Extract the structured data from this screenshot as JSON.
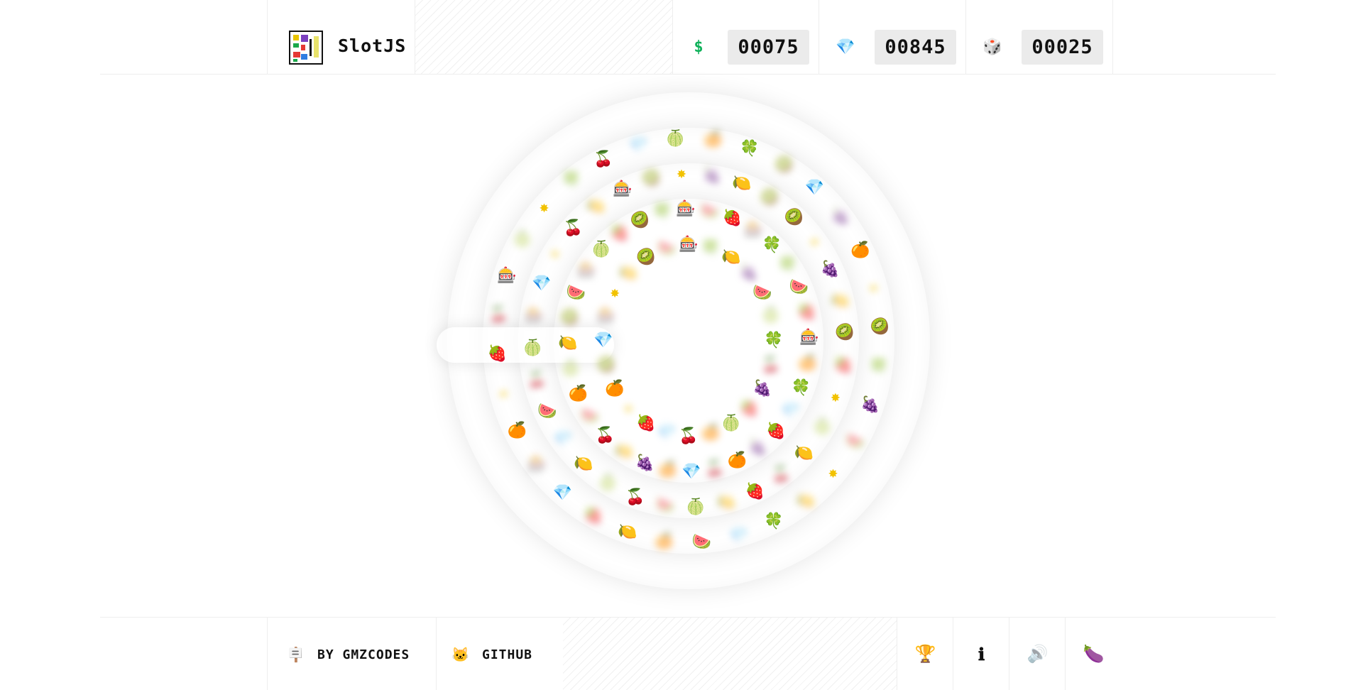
{
  "app": {
    "title": "SlotJS"
  },
  "counters": [
    {
      "name": "money",
      "icon": "dollar-icon",
      "glyph": "$",
      "color": "#0fb15a",
      "value": "00075"
    },
    {
      "name": "gems",
      "icon": "diamond-icon",
      "glyph": "💎",
      "color": "#1e88e5",
      "value": "00845"
    },
    {
      "name": "spins",
      "icon": "dice-icon",
      "glyph": "🎲",
      "color": "#7a7a9a",
      "value": "00025"
    }
  ],
  "footer": {
    "byline": {
      "label": "BY GMZCODES",
      "icon": "signpost-icon",
      "glyph": "🪧"
    },
    "github": {
      "label": "GITHUB",
      "icon": "github-cat-icon",
      "glyph": "🐱"
    },
    "buttons": [
      {
        "name": "trophy-button",
        "icon": "trophy-icon",
        "glyph": "🏆"
      },
      {
        "name": "info-button",
        "icon": "info-icon",
        "glyph": "ℹ"
      },
      {
        "name": "sound-button",
        "icon": "speaker-icon",
        "glyph": "🔊"
      },
      {
        "name": "eggplant-button",
        "icon": "eggplant-icon",
        "glyph": "🍆"
      }
    ]
  },
  "symbols": {
    "clover": "🍀",
    "star": "✸",
    "kiwi": "🥝",
    "lemon": "🍋",
    "watermelon": "🍉",
    "grapes": "🍇",
    "strawberry": "🍓",
    "orange": "🍊",
    "diamond": "💎",
    "cherries": "🍒",
    "melon": "🍈",
    "slot": "🎰"
  },
  "reels": [
    {
      "name": "reel-1",
      "symbols": [
        "clover",
        "grapes",
        "melon",
        "cherries",
        "strawberry",
        "orange",
        "diamond",
        "star",
        "kiwi",
        "slot",
        "lemon",
        "watermelon"
      ]
    },
    {
      "name": "reel-2",
      "symbols": [
        "clover",
        "strawberry",
        "orange",
        "diamond",
        "grapes",
        "cherries",
        "orange",
        "lemon",
        "watermelon",
        "melon",
        "kiwi",
        "slot",
        "strawberry",
        "clover",
        "watermelon",
        "slot"
      ]
    },
    {
      "name": "reel-3",
      "symbols": [
        "lemon",
        "strawberry",
        "melon",
        "cherries",
        "lemon",
        "watermelon",
        "melon",
        "diamond",
        "cherries",
        "slot",
        "star",
        "lemon",
        "kiwi",
        "grapes",
        "kiwi",
        "star"
      ]
    },
    {
      "name": "reel-4",
      "symbols": [
        "clover",
        "watermelon",
        "lemon",
        "diamond",
        "orange",
        "strawberry",
        "slot",
        "star",
        "cherries",
        "melon",
        "clover",
        "diamond",
        "orange",
        "kiwi",
        "grapes",
        "star"
      ]
    }
  ]
}
